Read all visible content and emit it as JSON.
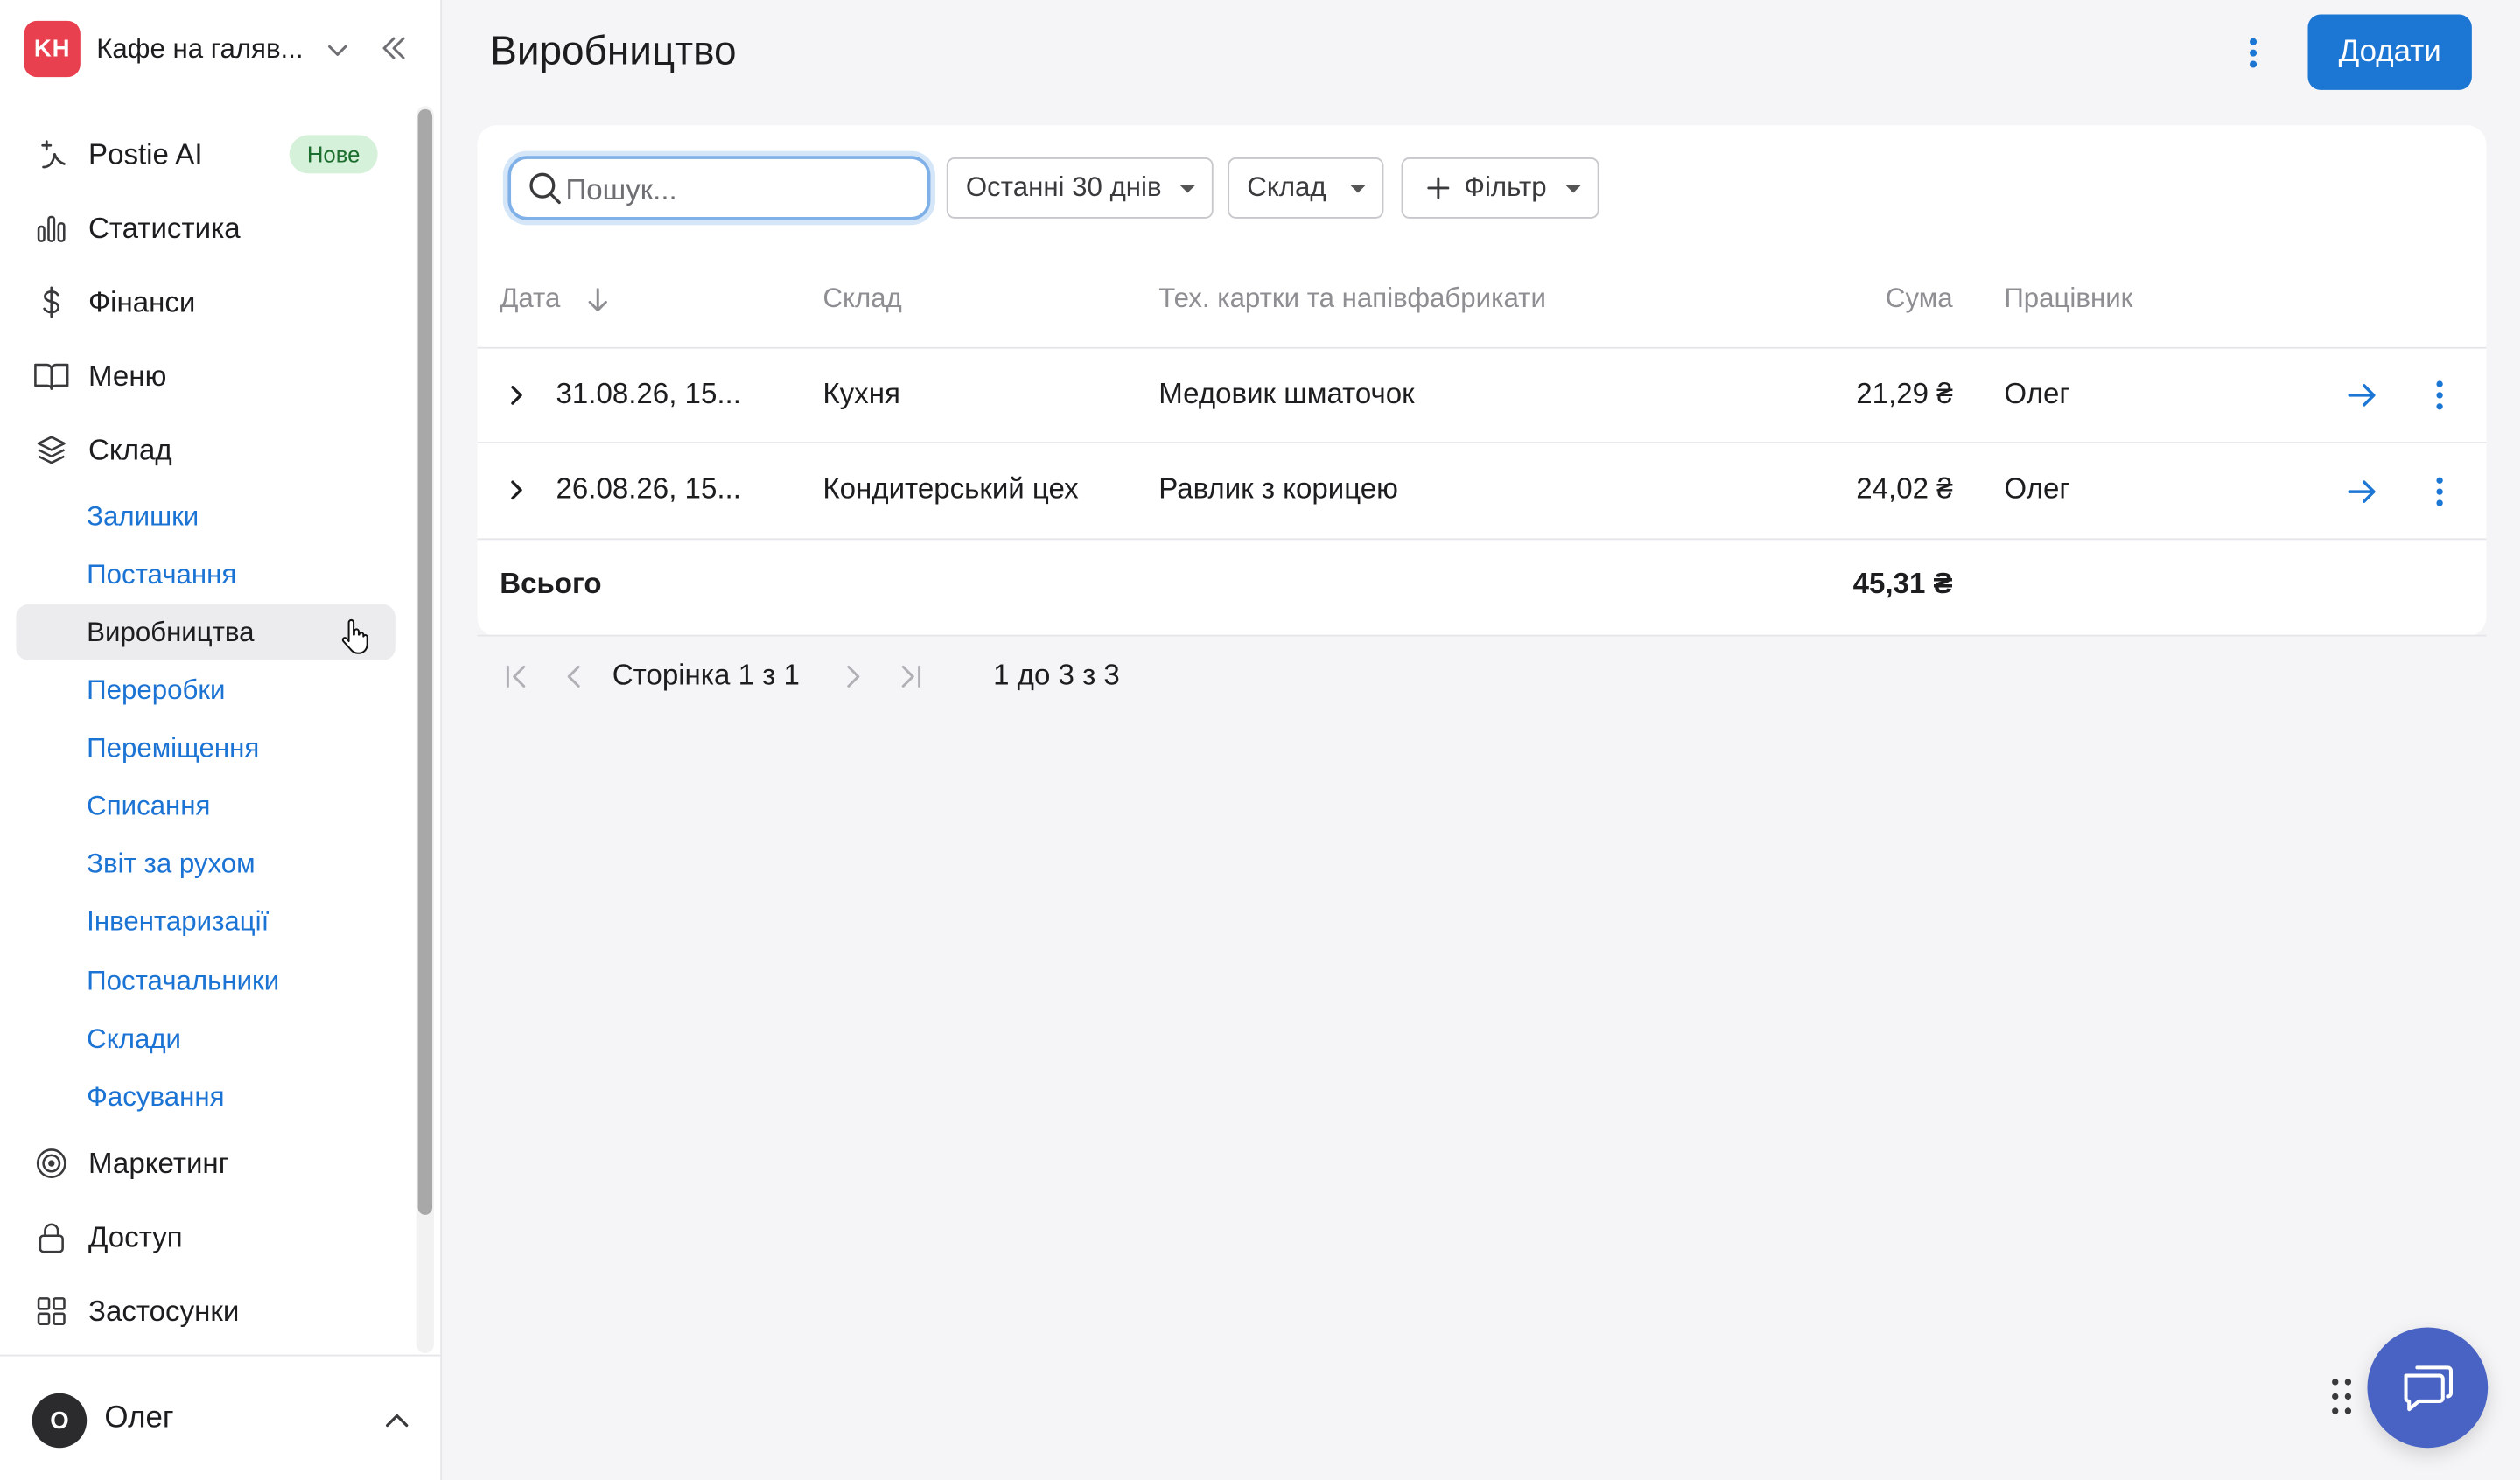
{
  "brand": {
    "initials": "KH",
    "name": "Кафе на галяв...",
    "color": "#e8404f"
  },
  "nav": {
    "items": [
      {
        "label": "Postie AI",
        "icon": "sparkle-icon",
        "badge": "Нове"
      },
      {
        "label": "Статистика",
        "icon": "bar-chart-icon"
      },
      {
        "label": "Фінанси",
        "icon": "dollar-icon"
      },
      {
        "label": "Меню",
        "icon": "book-icon"
      },
      {
        "label": "Склад",
        "icon": "layers-icon"
      },
      {
        "label": "Маркетинг",
        "icon": "target-icon"
      },
      {
        "label": "Доступ",
        "icon": "lock-icon"
      },
      {
        "label": "Застосунки",
        "icon": "grid-icon"
      }
    ],
    "sub_items": [
      {
        "label": "Залишки"
      },
      {
        "label": "Постачання"
      },
      {
        "label": "Виробництва",
        "active": true
      },
      {
        "label": "Переробки"
      },
      {
        "label": "Переміщення"
      },
      {
        "label": "Списання"
      },
      {
        "label": "Звіт за рухом"
      },
      {
        "label": "Інвентаризації"
      },
      {
        "label": "Постачальники"
      },
      {
        "label": "Склади"
      },
      {
        "label": "Фасування"
      }
    ]
  },
  "user": {
    "initial": "О",
    "name": "Олег"
  },
  "page": {
    "title": "Виробництво",
    "add_label": "Додати"
  },
  "filters": {
    "search_placeholder": "Пошук...",
    "period": "Останні 30 днів",
    "warehouse": "Склад",
    "add_filter": "Фільтр"
  },
  "table": {
    "headers": [
      "Дата",
      "Склад",
      "Тех. картки та напівфабрикати",
      "Сума",
      "Працівник"
    ],
    "rows": [
      {
        "date": "31.08.26, 15...",
        "warehouse": "Кухня",
        "item": "Медовик шматочок",
        "sum": "21,29 ₴",
        "employee": "Олег"
      },
      {
        "date": "26.08.26, 15...",
        "warehouse": "Кондитерський цех",
        "item": "Равлик з корицею",
        "sum": "24,02 ₴",
        "employee": "Олег"
      }
    ],
    "total_label": "Всього",
    "total_sum": "45,31 ₴"
  },
  "pagination": {
    "page_text": "Сторінка 1 з 1",
    "range_text": "1 до 3 з 3"
  },
  "colors": {
    "accent": "#1c76d3",
    "link": "#1b73d4",
    "chat": "#4863c4"
  }
}
